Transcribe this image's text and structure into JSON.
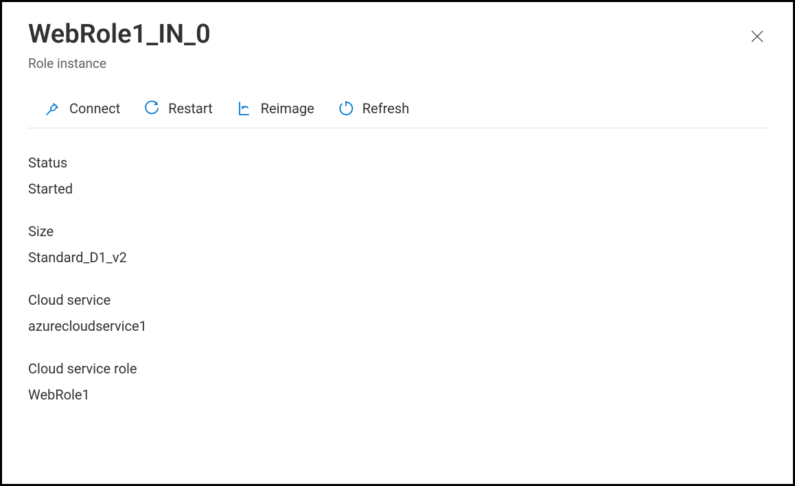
{
  "header": {
    "title": "WebRole1_IN_0",
    "subtitle": "Role instance"
  },
  "toolbar": {
    "connect_label": "Connect",
    "restart_label": "Restart",
    "reimage_label": "Reimage",
    "refresh_label": "Refresh"
  },
  "properties": {
    "status": {
      "label": "Status",
      "value": "Started"
    },
    "size": {
      "label": "Size",
      "value": "Standard_D1_v2"
    },
    "cloud_service": {
      "label": "Cloud service",
      "value": "azurecloudservice1"
    },
    "cloud_service_role": {
      "label": "Cloud service role",
      "value": "WebRole1"
    }
  }
}
